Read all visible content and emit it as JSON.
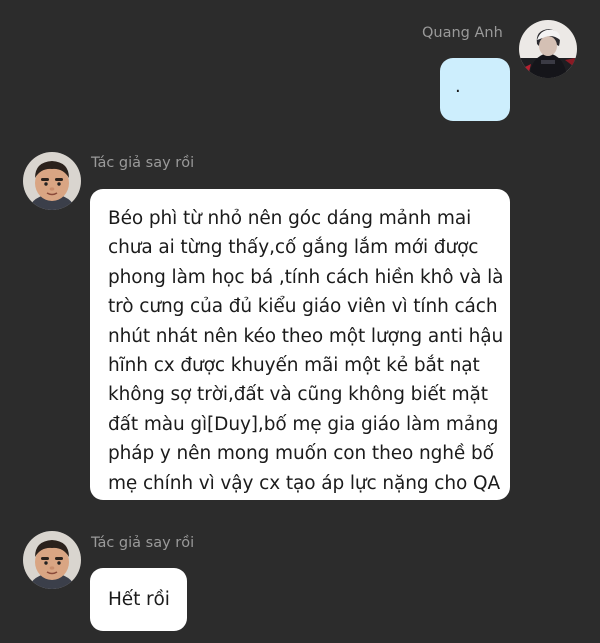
{
  "outgoing": {
    "sender_name": "Quang Anh",
    "text": "."
  },
  "incoming": [
    {
      "sender_name": "Tác giả say rồi",
      "lines": [
        "Béo phì từ nhỏ nên góc dáng mảnh mai",
        "chưa ai từng thấy,cố gắng lắm mới được",
        "phong làm học bá ,tính cách hiền khô và là",
        "trò cưng của đủ kiểu giáo viên vì tính cách",
        "nhút nhát nên kéo theo một lượng anti hậu",
        "hĩnh cx được khuyến mãi một kẻ bắt nạt",
        "không sợ trời,đất và cũng không biết mặt",
        "đất màu gì[Duy],bố mẹ gia giáo làm mảng",
        "pháp y nên mong muốn con theo nghề bố",
        "mẹ chính vì vậy cx tạo áp lực nặng cho QA"
      ]
    },
    {
      "sender_name": "Tác giả say rồi",
      "lines": [
        "Hết rồi"
      ]
    }
  ]
}
